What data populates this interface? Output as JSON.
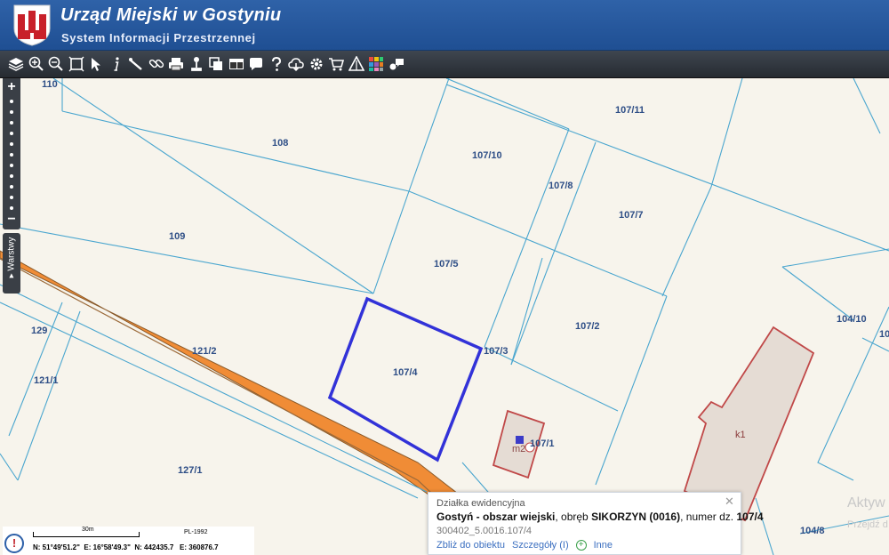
{
  "header": {
    "title": "Urząd Miejski w Gostyniu",
    "subtitle": "System Informacji Przestrzennej"
  },
  "toolbar": {
    "tools": [
      "layers-icon",
      "zoom-in-icon",
      "zoom-out-icon",
      "zoom-extent-icon",
      "select-arrow-icon",
      "info-icon",
      "measure-icon",
      "link-icon",
      "print-icon",
      "pin-icon",
      "copy-icon",
      "window-icon",
      "speech-bubble-icon",
      "help-icon",
      "cloud-icon",
      "settings-icon",
      "cart-icon",
      "triangle-icon",
      "color-grid-icon",
      "chat-icon"
    ]
  },
  "sidebar": {
    "zoom_plus": "+",
    "zoom_minus": "−",
    "layers_tab": "Warstwy"
  },
  "map": {
    "parcel_labels": [
      "110",
      "108",
      "107/11",
      "107/10",
      "107/8",
      "107/7",
      "109",
      "107/5",
      "107/2",
      "104/10",
      "129",
      "121/2",
      "107/3",
      "107/4",
      "121/1",
      "107/1",
      "m2",
      "k1",
      "127/1",
      "104/8",
      "10"
    ],
    "highlight_color": "#3232d8",
    "building_color": "#c9504f",
    "road_color": "#f39a43"
  },
  "popup": {
    "type": "Działka ewidencyjna",
    "place": "Gostyń - obszar wiejski",
    "precinct_label": ", obręb ",
    "precinct": "SIKORZYN (0016)",
    "number_label": ", numer dz.",
    "number": "107/4",
    "id": "300402_5.0016.107/4",
    "link_zoom": "Zbliż do obiektu",
    "link_details": "Szczegóły (I)",
    "link_more": "Inne"
  },
  "status": {
    "scale_label": "30m",
    "crs": "PL-1992",
    "lat": "N: 51°49'51.2\"",
    "lon": "E: 16°58'49.3\"",
    "north": "N: 442435.7",
    "east": "E: 360876.7"
  },
  "watermark": {
    "line1": "Aktyw",
    "line2": "Przejdź d"
  }
}
